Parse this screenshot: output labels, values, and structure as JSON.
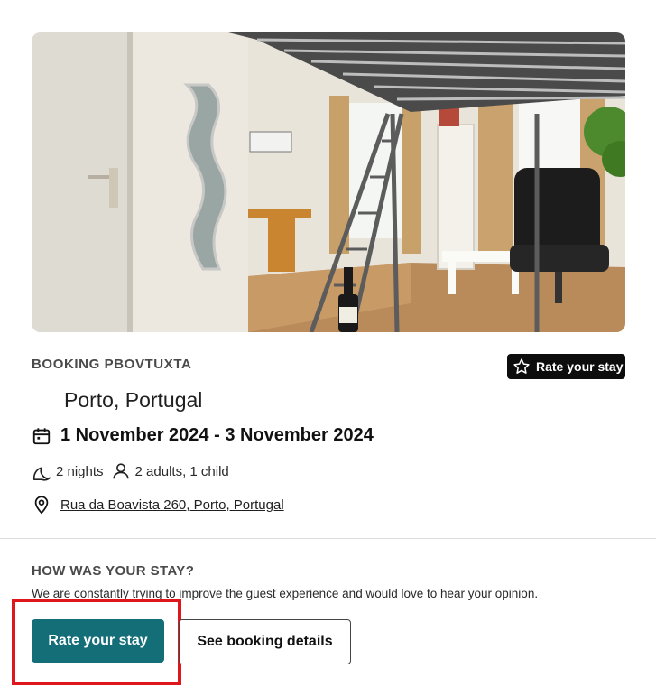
{
  "listing": {
    "photo_alt": "Studio apartment with loft bed"
  },
  "booking": {
    "reference": "BOOKING PBOVTUXTA",
    "rate_badge_label": "Rate your stay",
    "location": "Porto, Portugal",
    "dates": "1 November 2024 - 3 November 2024",
    "nights": "2 nights",
    "guests": "2 adults, 1 child",
    "address": "Rua da Boavista 260, Porto, Portugal"
  },
  "feedback": {
    "title": "HOW WAS YOUR STAY?",
    "description": "We are constantly trying to improve the guest experience and would love to hear your opinion.",
    "rate_button_label": "Rate your stay",
    "details_button_label": "See booking details"
  },
  "colors": {
    "primary_button": "#146e78",
    "badge_background": "#0d0d0d",
    "highlight_border": "#e0161d"
  },
  "icons": {
    "badge": "star-icon",
    "dates": "calendar-icon",
    "nights": "moon-icon",
    "guests": "person-icon",
    "address": "location-pin-icon"
  }
}
